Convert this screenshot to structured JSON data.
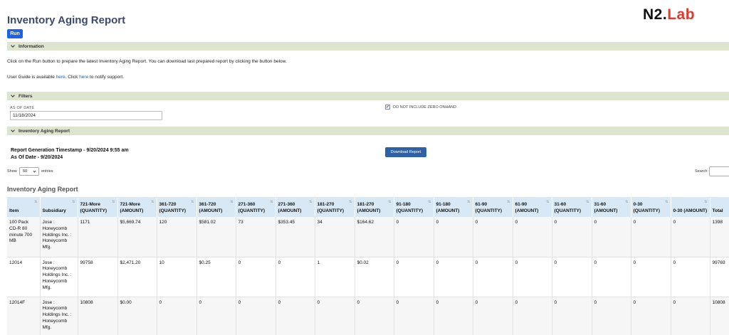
{
  "header": {
    "title": "Inventory Aging Report",
    "logo_main": "N2.",
    "logo_accent": "Lab",
    "run_label": "Run"
  },
  "sections": {
    "information": "Information",
    "filters": "Filters",
    "report": "Inventory Aging Report"
  },
  "information": {
    "line1": "Click on the Run button to prepare the latest Inventory Aging Report. You can download last prepared report by clicking the button below.",
    "line2_prefix": "User Guide is available ",
    "line2_link1": "here",
    "line2_mid": ". Click ",
    "line2_link2": "here",
    "line2_suffix": " to notify support."
  },
  "filters": {
    "as_of_label": "AS OF DATE",
    "as_of_value": "11/18/2024",
    "zero_onhand_label": "DO NOT INCLUDE ZERO ONHAND",
    "zero_onhand_checked": true
  },
  "report": {
    "timestamp": "Report Generation Timestamp - 9/20/2024 9:55 am",
    "as_of": "As Of Date - 9/20/2024",
    "download_label": "Download Report",
    "show_label": "Show",
    "show_value": "50",
    "entries_label": "entries",
    "search_label": "Search:",
    "table_title": "Inventory Aging Report"
  },
  "table": {
    "columns": [
      "Item",
      "Subsidiary",
      "721-More (QUANTITY)",
      "721-More (AMOUNT)",
      "361-720 (QUANTITY)",
      "361-720 (AMOUNT)",
      "271-360 (QUANTITY)",
      "271-360 (AMOUNT)",
      "181-270 (QUANTITY)",
      "181-270 (AMOUNT)",
      "91-180 (QUANTITY)",
      "91-180 (AMOUNT)",
      "61-90 (QUANTITY)",
      "61-90 (AMOUNT)",
      "31-60 (QUANTITY)",
      "31-60 (AMOUNT)",
      "0-30 (QUANTITY)",
      "0-30 (AMOUNT)",
      "Total"
    ],
    "rows": [
      [
        "100 Pack CD-R 80 minute 700 MB",
        "Jose : Honeycomb Holdings Inc. : Honeycomb Mfg.",
        "1171",
        "$5,669.74",
        "120",
        "$581.02",
        "73",
        "$353.45",
        "34",
        "$164.62",
        "0",
        "0",
        "0",
        "0",
        "0",
        "0",
        "0",
        "0",
        "1398"
      ],
      [
        "12014",
        "Jose : Honeycomb Holdings Inc. : Honeycomb Mfg.",
        "99758",
        "$2,471.20",
        "10",
        "$0.25",
        "0",
        "0",
        "1",
        "$0.02",
        "0",
        "0",
        "0",
        "0",
        "0",
        "0",
        "0",
        "0",
        "99769"
      ],
      [
        "12014F",
        "Jose : Honeycomb Holdings Inc. : Honeycomb Mfg.",
        "10808",
        "$0.00",
        "0",
        "0",
        "0",
        "0",
        "0",
        "0",
        "0",
        "0",
        "0",
        "0",
        "0",
        "0",
        "0",
        "0",
        "10808"
      ]
    ]
  },
  "colors": {
    "section_bar": "#dde5cf",
    "table_header": "#d8e8f4",
    "run_button": "#1a63e8",
    "download_button": "#2e62a6",
    "logo_accent": "#e03a2f",
    "link": "#1a5fc8"
  },
  "icons": {
    "section_toggle": "chevron-down-icon",
    "sort": "sort-icon",
    "checkbox": "checkmark-icon"
  }
}
